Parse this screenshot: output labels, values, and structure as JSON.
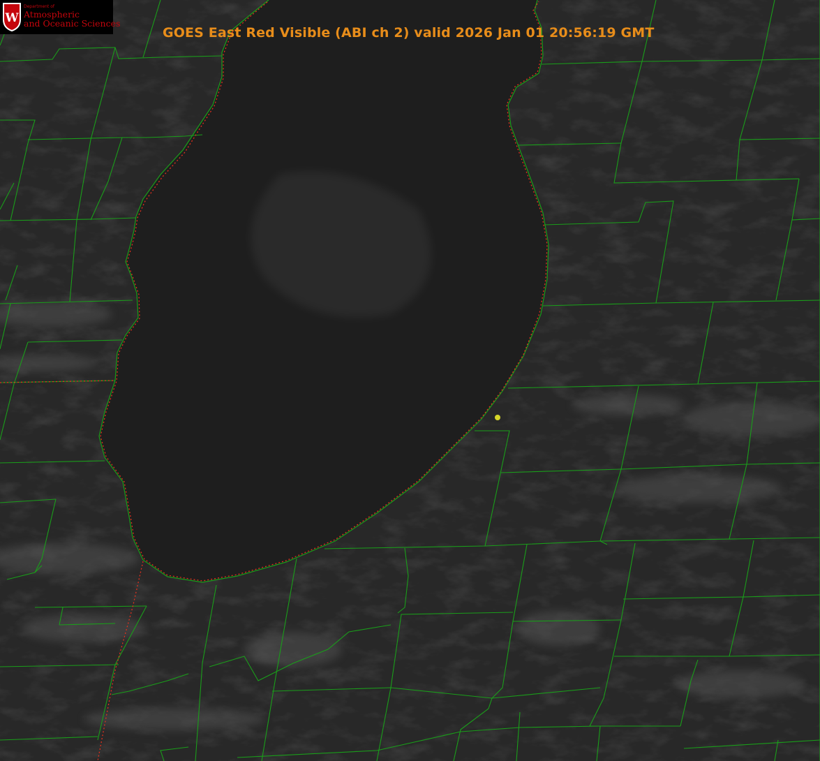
{
  "header": {
    "title": "GOES East Red Visible (ABI ch 2) valid 2026 Jan 01 20:56:19 GMT"
  },
  "logo": {
    "department": "Department of",
    "line1": "Atmospheric",
    "line2": "and Oceanic Sciences",
    "mark": "W"
  },
  "colors": {
    "title": "#e88d1a",
    "county_lines": "#1a9e1a",
    "state_border": "#e0301e",
    "location_marker": "#d6d629",
    "background": "#262626",
    "lake": "#1d1d1d",
    "logo_red": "#c5050c"
  }
}
